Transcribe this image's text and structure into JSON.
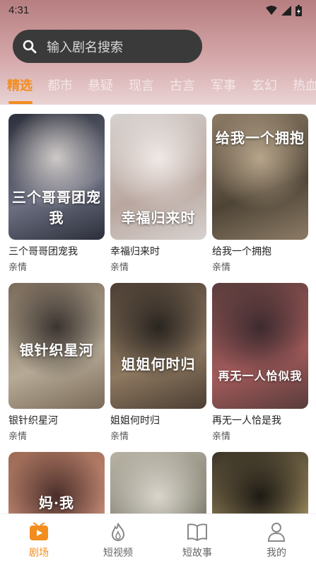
{
  "status": {
    "time": "4:31"
  },
  "search": {
    "placeholder": "输入剧名搜索"
  },
  "tabs": [
    {
      "label": "精选",
      "active": true
    },
    {
      "label": "都市"
    },
    {
      "label": "悬疑"
    },
    {
      "label": "现言"
    },
    {
      "label": "古言"
    },
    {
      "label": "军事"
    },
    {
      "label": "玄幻"
    },
    {
      "label": "热血"
    }
  ],
  "dramas": [
    {
      "title": "三个哥哥团宠我",
      "tag": "亲情",
      "poster_text": "三个哥哥团宠我",
      "colors": [
        "#2c2f3a",
        "#6b6e80",
        "#cfc9c7"
      ]
    },
    {
      "title": "幸福归来时",
      "tag": "亲情",
      "poster_text": "幸福归来时",
      "colors": [
        "#d7d2cf",
        "#b9a69f",
        "#efe9e6"
      ]
    },
    {
      "title": "给我一个拥抱",
      "tag": "亲情",
      "poster_text": "给我一个拥抱",
      "colors": [
        "#8c7b66",
        "#4e4436",
        "#b7a48a"
      ]
    },
    {
      "title": "银针织星河",
      "tag": "亲情",
      "poster_text": "银针织星河",
      "colors": [
        "#7a6a59",
        "#b6aa96",
        "#3a3430"
      ]
    },
    {
      "title": "姐姐何时归",
      "tag": "亲情",
      "poster_text": "姐姐何时归",
      "colors": [
        "#4b3e33",
        "#8d7860",
        "#2a2520"
      ]
    },
    {
      "title": "再无一人恰是我",
      "tag": "亲情",
      "poster_text": "再无一人恰似我",
      "colors": [
        "#5a3c3c",
        "#a25a5a",
        "#3d2b2f"
      ]
    },
    {
      "title": "",
      "tag": "",
      "poster_text": "妈·我",
      "colors": [
        "#9c6a55",
        "#c78c78",
        "#4a2e2a"
      ]
    },
    {
      "title": "",
      "tag": "",
      "poster_text": "",
      "colors": [
        "#b8b3a5",
        "#7c7a6c",
        "#d9d5cc"
      ]
    },
    {
      "title": "",
      "tag": "",
      "poster_text": "",
      "colors": [
        "#3b3426",
        "#9c8a5e",
        "#1e1a14"
      ]
    }
  ],
  "nav": [
    {
      "label": "剧场",
      "icon": "theater-icon",
      "active": true
    },
    {
      "label": "短视频",
      "icon": "flame-icon"
    },
    {
      "label": "短故事",
      "icon": "book-icon"
    },
    {
      "label": "我的",
      "icon": "user-icon"
    }
  ],
  "colors": {
    "accent": "#f28d1e"
  }
}
